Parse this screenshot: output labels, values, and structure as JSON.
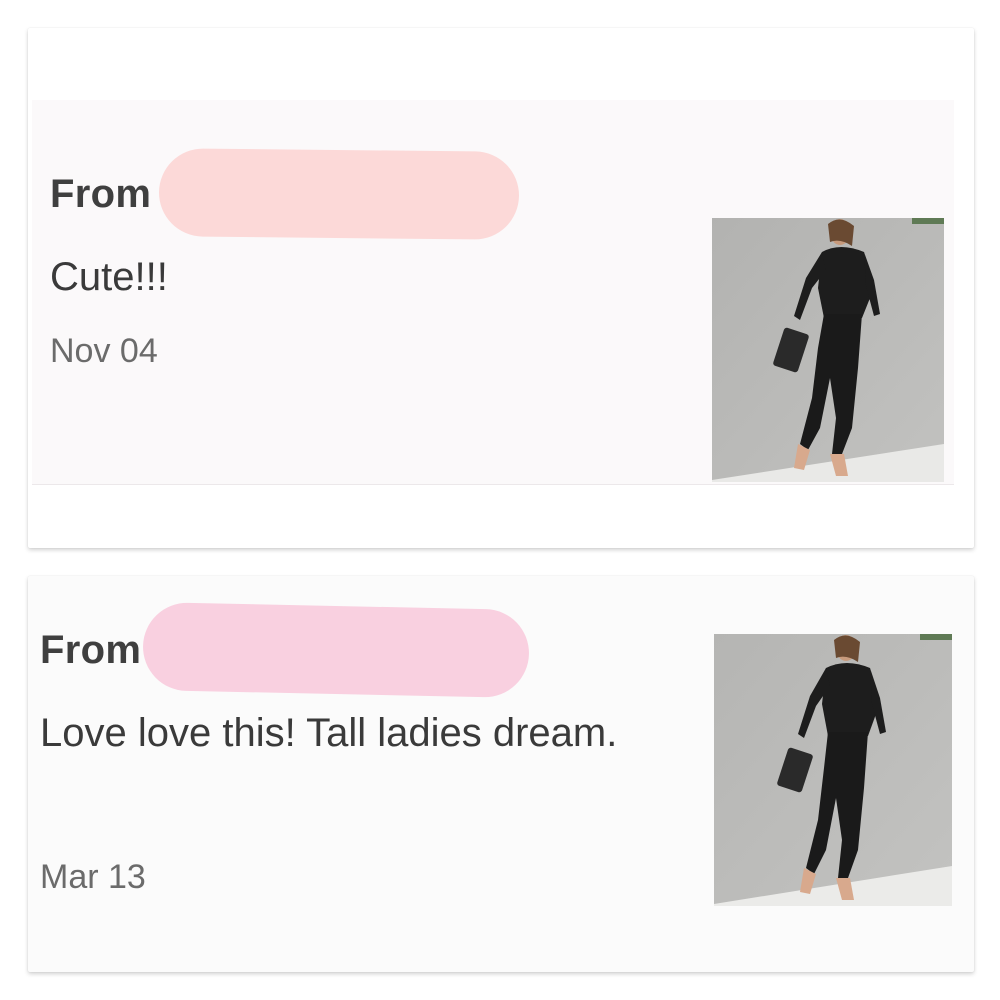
{
  "messages": [
    {
      "from_label": "From",
      "text": "Cute!!!",
      "date": "Nov 04",
      "thumbnail": "black-jumpsuit-product-photo"
    },
    {
      "from_label": "From",
      "text": "Love love this! Tall ladies dream.",
      "date": "Mar 13",
      "thumbnail": "black-jumpsuit-product-photo"
    }
  ],
  "colors": {
    "redaction_1": "#fcd9d8",
    "redaction_2": "#f9d0e0",
    "text": "#3a3a3a",
    "date": "#6b6b6b"
  }
}
